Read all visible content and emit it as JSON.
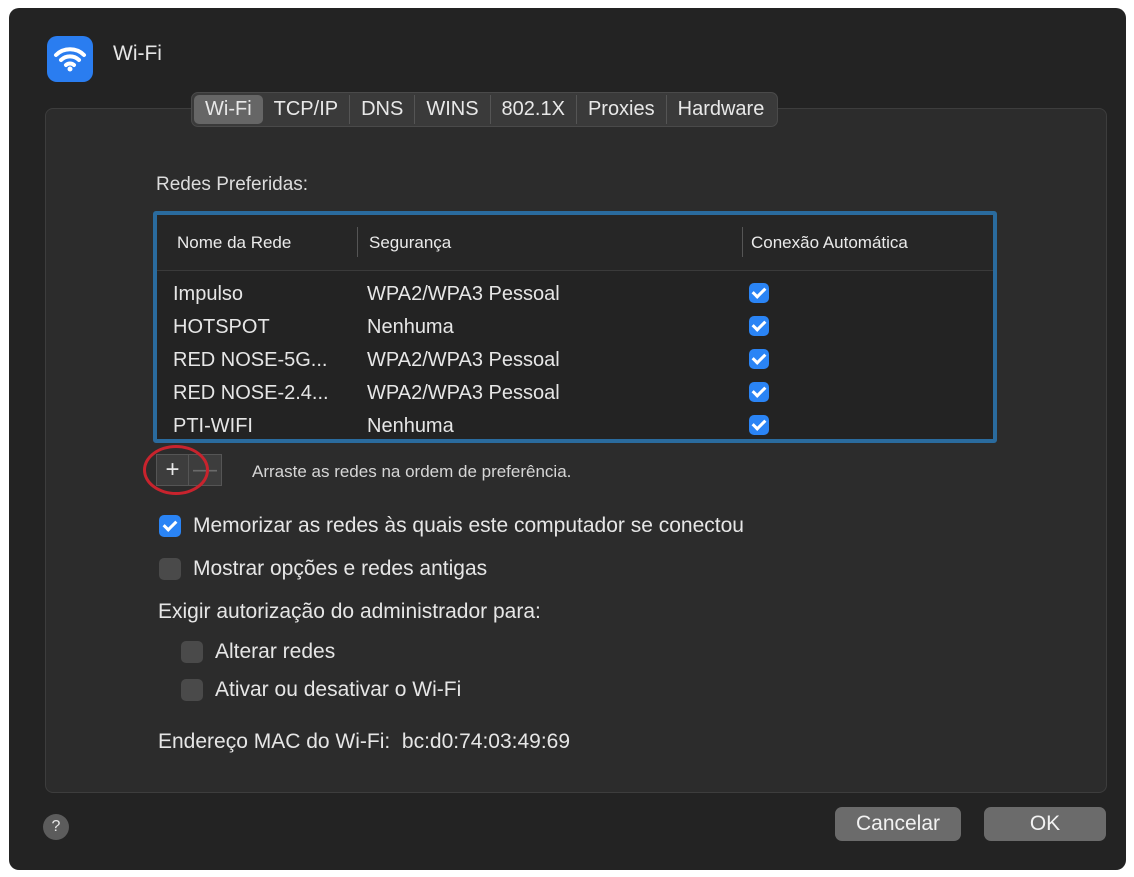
{
  "window": {
    "title": "Wi-Fi",
    "icon": "wifi-icon"
  },
  "tabs": [
    "Wi-Fi",
    "TCP/IP",
    "DNS",
    "WINS",
    "802.1X",
    "Proxies",
    "Hardware"
  ],
  "active_tab": "Wi-Fi",
  "preferred_label": "Redes Preferidas:",
  "table": {
    "columns": [
      "Nome da Rede",
      "Segurança",
      "Conexão Automática"
    ],
    "rows": [
      {
        "name": "Impulso",
        "security": "WPA2/WPA3 Pessoal",
        "auto": true
      },
      {
        "name": "HOTSPOT",
        "security": "Nenhuma",
        "auto": true
      },
      {
        "name": "RED NOSE-5G...",
        "security": "WPA2/WPA3 Pessoal",
        "auto": true
      },
      {
        "name": "RED NOSE-2.4...",
        "security": "WPA2/WPA3 Pessoal",
        "auto": true
      },
      {
        "name": "PTI-WIFI",
        "security": "Nenhuma",
        "auto": true
      }
    ]
  },
  "add_button": "+",
  "remove_button": "—",
  "drag_hint": "Arraste as redes na ordem de preferência.",
  "options": {
    "remember": {
      "label": "Memorizar as redes às quais este computador se conectou",
      "checked": true
    },
    "legacy": {
      "label": "Mostrar opções e redes antigas",
      "checked": false
    }
  },
  "admin_label": "Exigir autorização do administrador para:",
  "admin_options": {
    "change": {
      "label": "Alterar redes",
      "checked": false
    },
    "toggle": {
      "label": "Ativar ou desativar o Wi-Fi",
      "checked": false
    }
  },
  "mac": "Endereço MAC do Wi-Fi:  bc:d0:74:03:49:69",
  "help": "?",
  "cancel": "Cancelar",
  "ok": "OK"
}
